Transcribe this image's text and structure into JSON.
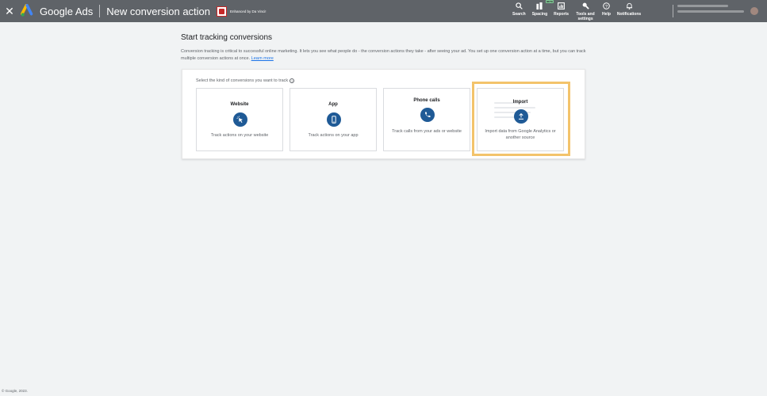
{
  "topbar": {
    "close_icon": "close-icon",
    "brand": "Google Ads",
    "page_title": "New conversion action",
    "enhanced_text": "Enhanced by Da Vinci!",
    "nav": [
      {
        "icon": "search-icon",
        "label": "Search",
        "badge": ""
      },
      {
        "icon": "spacing-icon",
        "label": "Spacing",
        "badge": "BETA"
      },
      {
        "icon": "reports-icon",
        "label": "Reports",
        "badge": ""
      },
      {
        "icon": "wrench-icon",
        "label": "Tools and settings",
        "badge": ""
      },
      {
        "icon": "help-icon",
        "label": "Help",
        "badge": ""
      },
      {
        "icon": "bell-icon",
        "label": "Notifications",
        "badge": ""
      }
    ]
  },
  "main": {
    "heading": "Start tracking conversions",
    "description": "Conversion tracking is critical to successful online marketing. It lets you see what people do - the conversion actions they take - after seeing your ad. You set up one conversion action at a time, but you can track multiple conversion actions at once.",
    "learn_more": "Learn more",
    "select_label": "Select the kind of conversions you want to track",
    "cards": [
      {
        "title": "Website",
        "icon": "cursor-click-icon",
        "description": "Track actions on your website"
      },
      {
        "title": "App",
        "icon": "phone-device-icon",
        "description": "Track actions on your app"
      },
      {
        "title": "Phone calls",
        "icon": "phone-call-icon",
        "description": "Track calls from your ads or website"
      },
      {
        "title": "Import",
        "icon": "upload-icon",
        "description": "Import data from Google Analytics or another source"
      }
    ]
  },
  "footer": {
    "text": "© Google, 2023."
  },
  "colors": {
    "topbar": "#5f6368",
    "icon_circle": "#1f5a96",
    "highlight": "#f3c36b",
    "link": "#1a73e8"
  }
}
